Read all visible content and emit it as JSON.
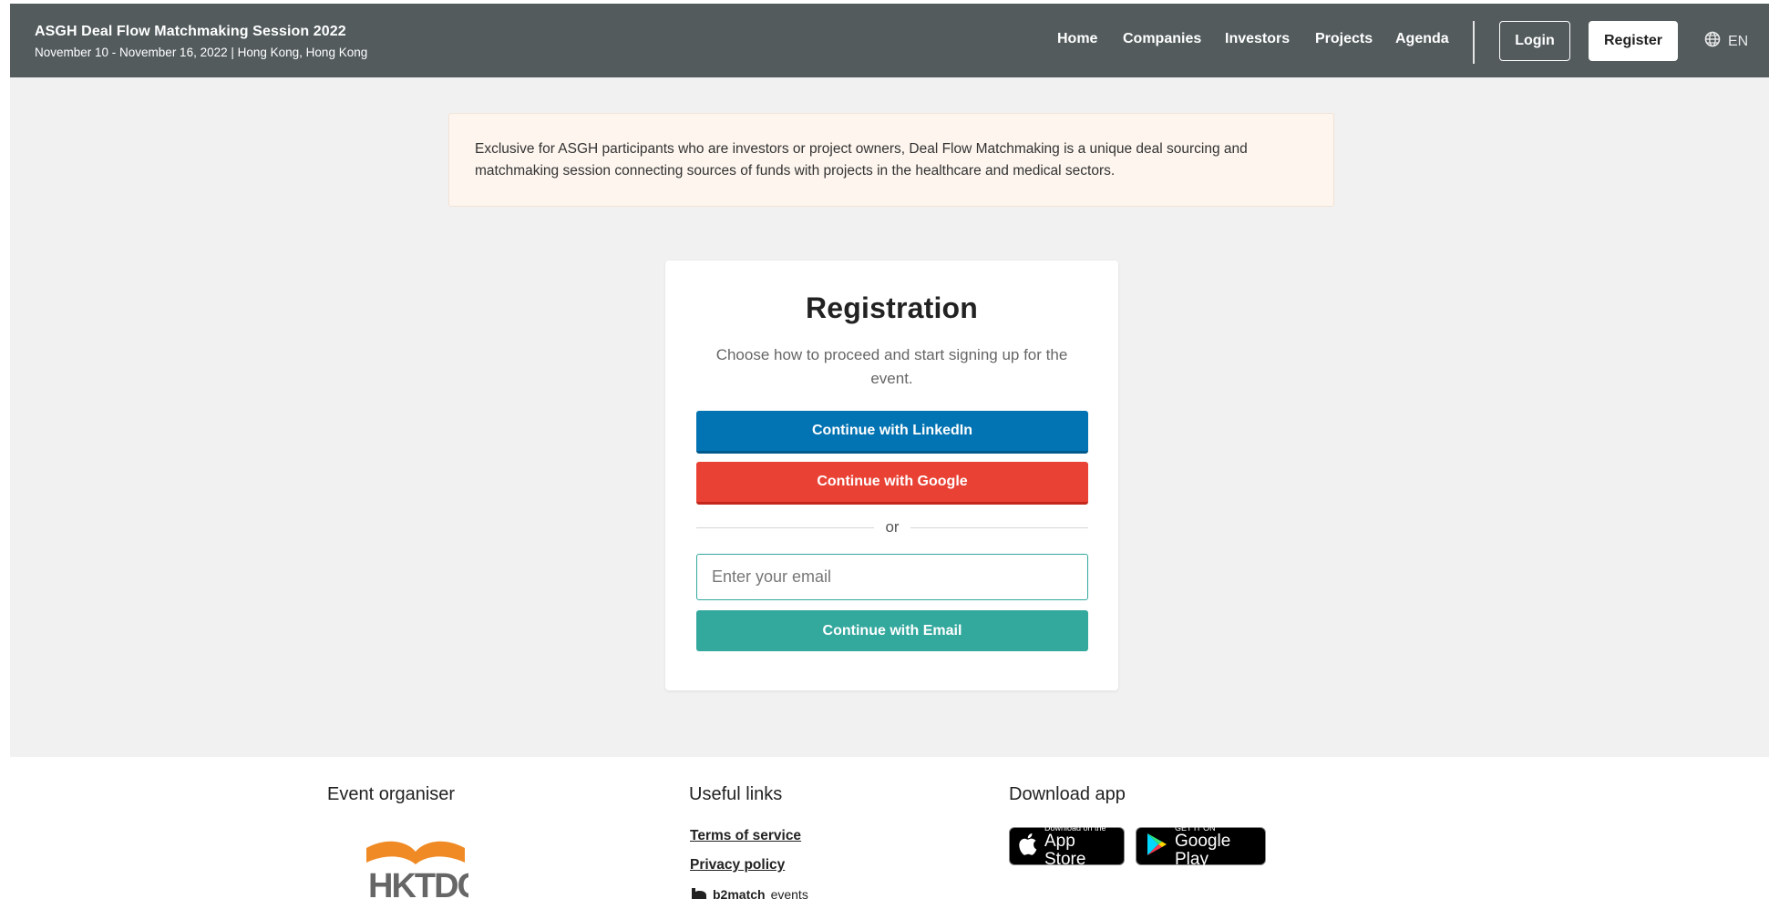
{
  "header": {
    "title": "ASGH Deal Flow Matchmaking Session 2022",
    "subtitle": "November 10 - November 16, 2022 | Hong Kong, Hong Kong",
    "nav": [
      "Home",
      "Companies",
      "Investors",
      "Projects",
      "Agenda"
    ],
    "login_label": "Login",
    "register_label": "Register",
    "language": "EN"
  },
  "notice": {
    "text": "Exclusive for ASGH participants who are investors or project owners, Deal Flow Matchmaking is a unique deal sourcing and matchmaking session connecting sources of funds with projects in the healthcare and medical sectors."
  },
  "registration": {
    "title": "Registration",
    "description": "Choose how to proceed and start signing up for the event.",
    "linkedin_label": "Continue with LinkedIn",
    "google_label": "Continue with Google",
    "or_label": "or",
    "email_placeholder": "Enter your email",
    "email_button_label": "Continue with Email"
  },
  "footer": {
    "organiser_heading": "Event organiser",
    "organiser_logo_text": "HKTDC",
    "links_heading": "Useful links",
    "links": [
      "Terms of service",
      "Privacy policy"
    ],
    "b2match_brand": "b2match",
    "b2match_suffix": "events",
    "download_heading": "Download app",
    "app_store": {
      "small": "Download on the",
      "big": "App Store"
    },
    "google_play": {
      "small": "GET IT ON",
      "big": "Google Play"
    }
  },
  "colors": {
    "header_bg": "#535b5d",
    "linkedin": "#0273b3",
    "google": "#e94235",
    "email_accent": "#33a89d",
    "notice_bg": "#fdf5ee",
    "page_bg": "#f1f1f1",
    "hktdc_orange": "#f08a24"
  },
  "icons": {
    "language": "globe-icon",
    "app_store": "apple-icon",
    "google_play": "play-triangle-icon"
  }
}
